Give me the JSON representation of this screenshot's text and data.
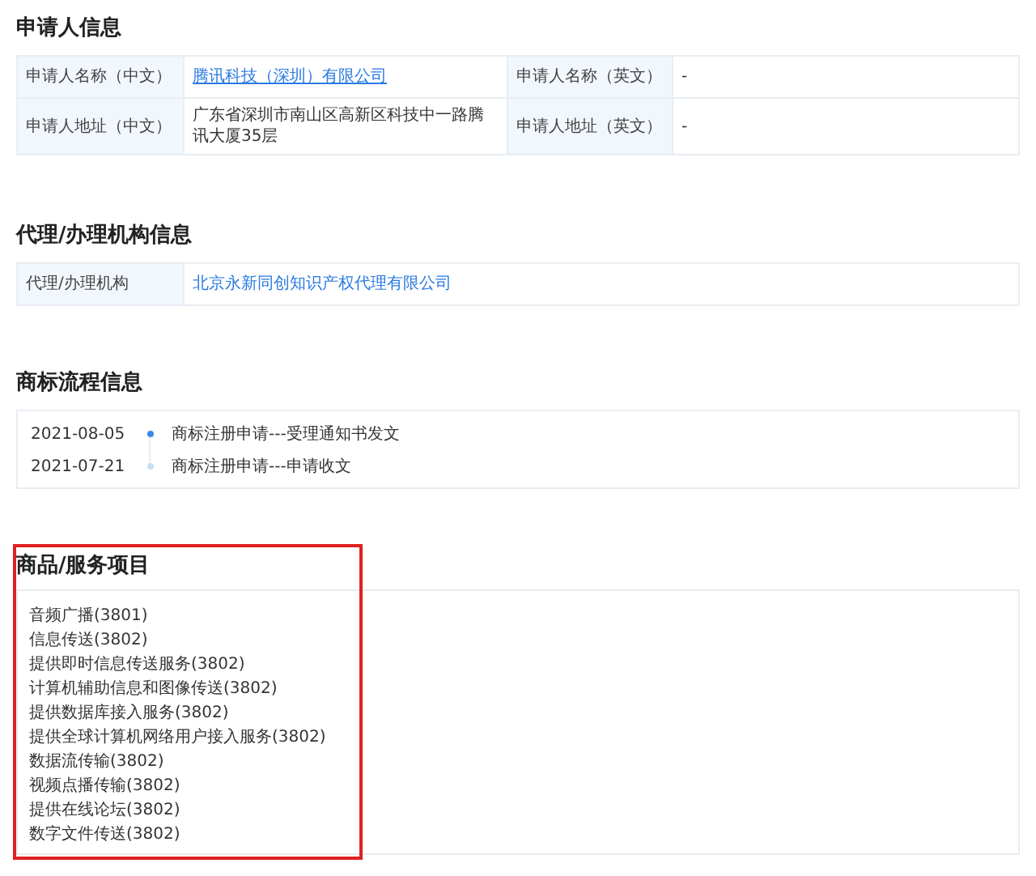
{
  "applicant": {
    "title": "申请人信息",
    "rows": [
      {
        "cells": [
          {
            "kind": "label",
            "text": "申请人名称（中文）"
          },
          {
            "kind": "link",
            "text": "腾讯科技（深圳）有限公司",
            "underlined": true
          },
          {
            "kind": "label",
            "text": "申请人名称（英文）"
          },
          {
            "kind": "text",
            "text": "-"
          }
        ]
      },
      {
        "cells": [
          {
            "kind": "label",
            "text": "申请人地址（中文）"
          },
          {
            "kind": "text",
            "text": "广东省深圳市南山区高新区科技中一路腾讯大厦35层"
          },
          {
            "kind": "label",
            "text": "申请人地址（英文）"
          },
          {
            "kind": "text",
            "text": "-"
          }
        ]
      }
    ]
  },
  "agent": {
    "title": "代理/办理机构信息",
    "rows": [
      {
        "cells": [
          {
            "kind": "label",
            "text": "代理/办理机构"
          },
          {
            "kind": "link",
            "text": "北京永新同创知识产权代理有限公司",
            "underlined": false
          }
        ]
      }
    ]
  },
  "process": {
    "title": "商标流程信息",
    "events": [
      {
        "date": "2021-08-05",
        "text": "商标注册申请---受理通知书发文",
        "current": true
      },
      {
        "date": "2021-07-21",
        "text": "商标注册申请---申请收文",
        "current": false
      }
    ]
  },
  "goods": {
    "title": "商品/服务项目",
    "highlighted": true,
    "items": [
      "音频广播(3801)",
      "信息传送(3802)",
      "提供即时信息传送服务(3802)",
      "计算机辅助信息和图像传送(3802)",
      "提供数据库接入服务(3802)",
      "提供全球计算机网络用户接入服务(3802)",
      "数据流传输(3802)",
      "视频点播传输(3802)",
      "提供在线论坛(3802)",
      "数字文件传送(3802)"
    ]
  }
}
